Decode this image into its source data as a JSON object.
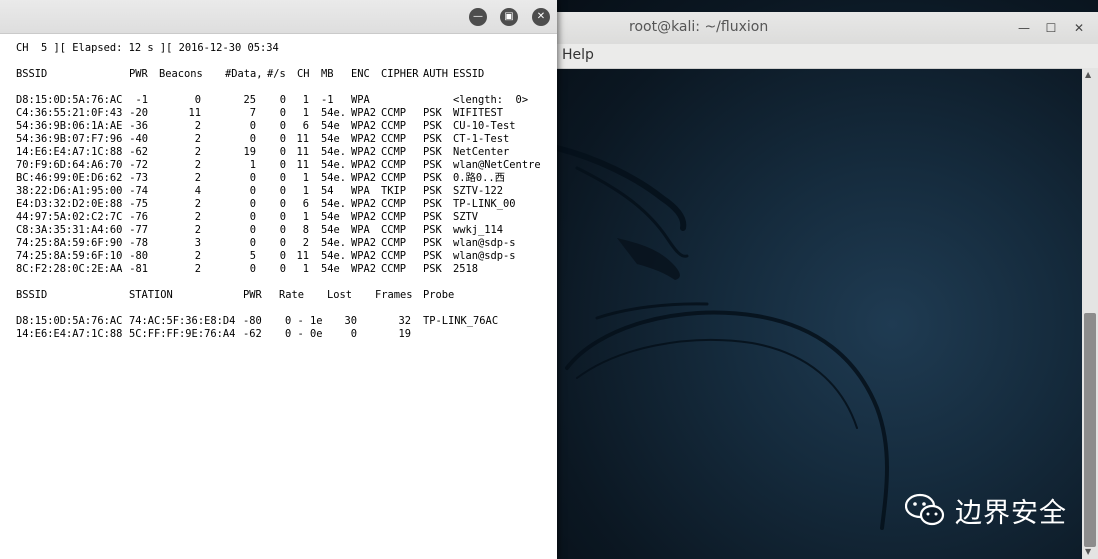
{
  "background_window": {
    "title": "root@kali: ~/fluxion",
    "menu_help": "Help",
    "minimize_glyph": "—",
    "maximize_glyph": "☐",
    "close_glyph": "✕",
    "watermark_text": "边界安全"
  },
  "foreground_window": {
    "minimize_glyph": "—",
    "maximize_glyph": "▣",
    "close_glyph": "✕"
  },
  "airodump": {
    "status_line": "CH  5 ][ Elapsed: 12 s ][ 2016-12-30 05:34",
    "ap_headers": {
      "bssid": "BSSID",
      "pwr": "PWR",
      "beacons": "Beacons",
      "data": "#Data,",
      "per_s": "#/s",
      "ch": "CH",
      "mb": "MB",
      "enc": "ENC",
      "cipher": "CIPHER",
      "auth": "AUTH",
      "essid": "ESSID"
    },
    "access_points": [
      {
        "bssid": "D8:15:0D:5A:76:AC",
        "pwr": "-1",
        "beacons": "0",
        "data": "25",
        "per_s": "0",
        "ch": "1",
        "mb": "-1",
        "enc": "WPA",
        "cipher": "",
        "auth": "",
        "essid": "<length:  0>"
      },
      {
        "bssid": "C4:36:55:21:0F:43",
        "pwr": "-20",
        "beacons": "11",
        "data": "7",
        "per_s": "0",
        "ch": "1",
        "mb": "54e.",
        "enc": "WPA2",
        "cipher": "CCMP",
        "auth": "PSK",
        "essid": "WIFITEST"
      },
      {
        "bssid": "54:36:9B:06:1A:AE",
        "pwr": "-36",
        "beacons": "2",
        "data": "0",
        "per_s": "0",
        "ch": "6",
        "mb": "54e",
        "enc": "WPA2",
        "cipher": "CCMP",
        "auth": "PSK",
        "essid": "CU-10-Test"
      },
      {
        "bssid": "54:36:9B:07:F7:96",
        "pwr": "-40",
        "beacons": "2",
        "data": "0",
        "per_s": "0",
        "ch": "11",
        "mb": "54e",
        "enc": "WPA2",
        "cipher": "CCMP",
        "auth": "PSK",
        "essid": "CT-1-Test"
      },
      {
        "bssid": "14:E6:E4:A7:1C:88",
        "pwr": "-62",
        "beacons": "2",
        "data": "19",
        "per_s": "0",
        "ch": "11",
        "mb": "54e.",
        "enc": "WPA2",
        "cipher": "CCMP",
        "auth": "PSK",
        "essid": "NetCenter"
      },
      {
        "bssid": "70:F9:6D:64:A6:70",
        "pwr": "-72",
        "beacons": "2",
        "data": "1",
        "per_s": "0",
        "ch": "11",
        "mb": "54e.",
        "enc": "WPA2",
        "cipher": "CCMP",
        "auth": "PSK",
        "essid": "wlan@NetCentre"
      },
      {
        "bssid": "BC:46:99:0E:D6:62",
        "pwr": "-73",
        "beacons": "2",
        "data": "0",
        "per_s": "0",
        "ch": "1",
        "mb": "54e.",
        "enc": "WPA2",
        "cipher": "CCMP",
        "auth": "PSK",
        "essid": "0.路0..西"
      },
      {
        "bssid": "38:22:D6:A1:95:00",
        "pwr": "-74",
        "beacons": "4",
        "data": "0",
        "per_s": "0",
        "ch": "1",
        "mb": "54",
        "enc": "WPA",
        "cipher": "TKIP",
        "auth": "PSK",
        "essid": "SZTV-122"
      },
      {
        "bssid": "E4:D3:32:D2:0E:88",
        "pwr": "-75",
        "beacons": "2",
        "data": "0",
        "per_s": "0",
        "ch": "6",
        "mb": "54e.",
        "enc": "WPA2",
        "cipher": "CCMP",
        "auth": "PSK",
        "essid": "TP-LINK_00"
      },
      {
        "bssid": "44:97:5A:02:C2:7C",
        "pwr": "-76",
        "beacons": "2",
        "data": "0",
        "per_s": "0",
        "ch": "1",
        "mb": "54e",
        "enc": "WPA2",
        "cipher": "CCMP",
        "auth": "PSK",
        "essid": "SZTV"
      },
      {
        "bssid": "C8:3A:35:31:A4:60",
        "pwr": "-77",
        "beacons": "2",
        "data": "0",
        "per_s": "0",
        "ch": "8",
        "mb": "54e",
        "enc": "WPA",
        "cipher": "CCMP",
        "auth": "PSK",
        "essid": "wwkj_114"
      },
      {
        "bssid": "74:25:8A:59:6F:90",
        "pwr": "-78",
        "beacons": "3",
        "data": "0",
        "per_s": "0",
        "ch": "2",
        "mb": "54e.",
        "enc": "WPA2",
        "cipher": "CCMP",
        "auth": "PSK",
        "essid": "wlan@sdp-s"
      },
      {
        "bssid": "74:25:8A:59:6F:10",
        "pwr": "-80",
        "beacons": "2",
        "data": "5",
        "per_s": "0",
        "ch": "11",
        "mb": "54e.",
        "enc": "WPA2",
        "cipher": "CCMP",
        "auth": "PSK",
        "essid": "wlan@sdp-s"
      },
      {
        "bssid": "8C:F2:28:0C:2E:AA",
        "pwr": "-81",
        "beacons": "2",
        "data": "0",
        "per_s": "0",
        "ch": "1",
        "mb": "54e",
        "enc": "WPA2",
        "cipher": "CCMP",
        "auth": "PSK",
        "essid": "2518"
      }
    ],
    "station_headers": {
      "bssid": "BSSID",
      "station": "STATION",
      "pwr": "PWR",
      "rate": "Rate",
      "lost": "Lost",
      "frames": "Frames",
      "probe": "Probe"
    },
    "stations": [
      {
        "bssid": "D8:15:0D:5A:76:AC",
        "station": "74:AC:5F:36:E8:D4",
        "pwr": "-80",
        "rate": "0 - 1e",
        "lost": "30",
        "frames": "32",
        "probe": "TP-LINK_76AC"
      },
      {
        "bssid": "14:E6:E4:A7:1C:88",
        "station": "5C:FF:FF:9E:76:A4",
        "pwr": "-62",
        "rate": "0 - 0e",
        "lost": "0",
        "frames": "19",
        "probe": ""
      }
    ]
  }
}
